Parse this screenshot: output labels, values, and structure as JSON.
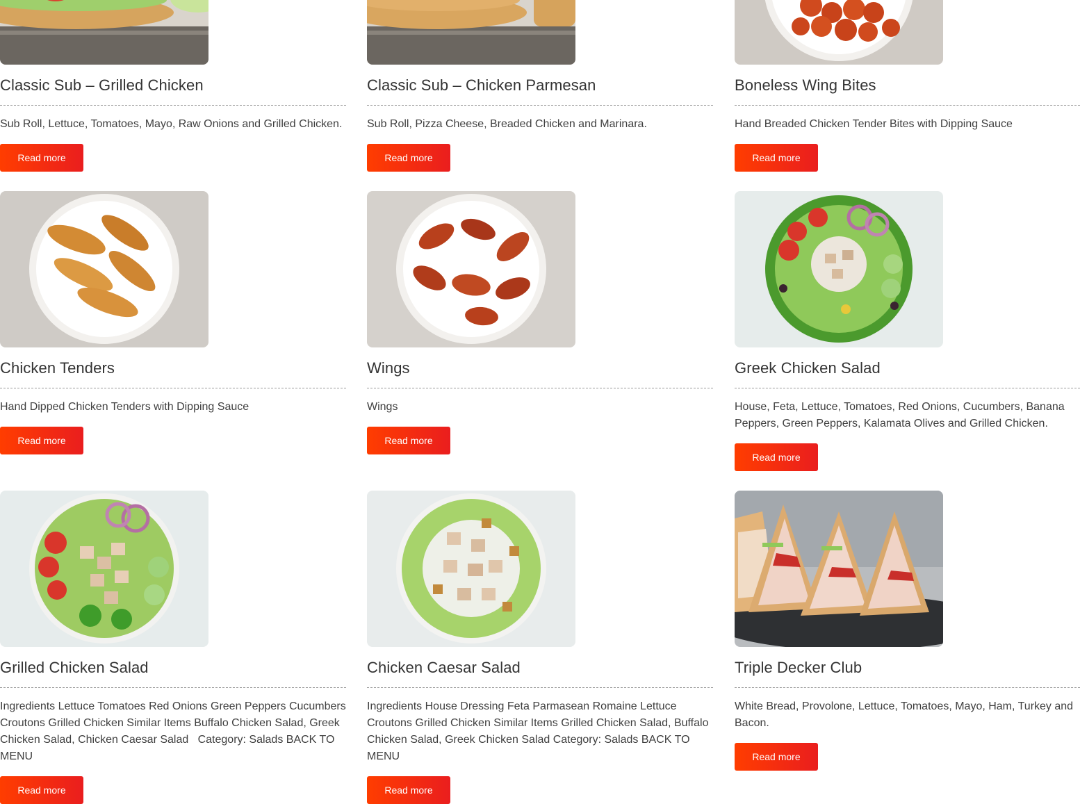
{
  "read_more_label": "Read more",
  "colors": {
    "accent": "#FF3300",
    "title": "#333333",
    "text": "#3F3F3F"
  },
  "items": [
    {
      "title": "Classic Sub – Grilled Chicken",
      "description": "Sub Roll, Lettuce, Tomatoes, Mayo, Raw Onions and Grilled Chicken.",
      "image": "grilled-chicken-sub-image"
    },
    {
      "title": "Classic Sub – Chicken Parmesan",
      "description": "Sub Roll, Pizza Cheese, Breaded Chicken and Marinara.",
      "image": "chicken-parmesan-sub-image"
    },
    {
      "title": "Boneless Wing Bites",
      "description": "Hand Breaded Chicken Tender Bites with Dipping Sauce",
      "image": "boneless-wing-bites-image"
    },
    {
      "title": "Chicken Tenders",
      "description": "Hand Dipped Chicken Tenders with Dipping Sauce",
      "image": "chicken-tenders-image"
    },
    {
      "title": "Wings",
      "description": "Wings",
      "image": "wings-image"
    },
    {
      "title": "Greek Chicken Salad",
      "description": "House, Feta, Lettuce, Tomatoes, Red Onions, Cucumbers, Banana Peppers, Green Peppers, Kalamata Olives and Grilled Chicken.",
      "image": "greek-chicken-salad-image"
    },
    {
      "title": "Grilled Chicken Salad",
      "description": "Ingredients Lettuce Tomatoes Red Onions Green Peppers Cucumbers Croutons Grilled Chicken Similar Items Buffalo Chicken Salad, Greek Chicken Salad, Chicken Caesar Salad   Category: Salads BACK TO MENU",
      "image": "grilled-chicken-salad-image"
    },
    {
      "title": "Chicken Caesar Salad",
      "description": "Ingredients House Dressing Feta Parmasean Romaine Lettuce Croutons Grilled Chicken Similar Items Grilled Chicken Salad, Buffalo Chicken Salad, Greek Chicken Salad Category: Salads BACK TO MENU",
      "image": "chicken-caesar-salad-image"
    },
    {
      "title": "Triple Decker Club",
      "description": "White Bread, Provolone, Lettuce, Tomatoes, Mayo, Ham, Turkey and Bacon.",
      "image": "triple-decker-club-image"
    }
  ]
}
